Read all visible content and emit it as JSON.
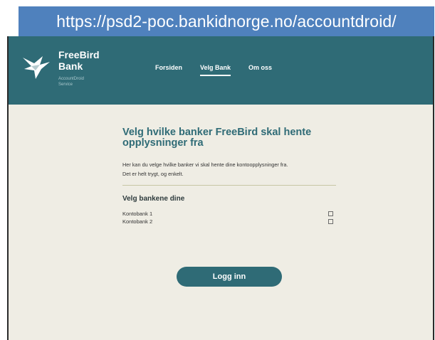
{
  "browser": {
    "url": "https://psd2-poc.bankidnorge.no/accountdroid/"
  },
  "header": {
    "logo": {
      "name_line1": "FreeBird",
      "name_line2": "Bank",
      "sub_line1": "AccountDroid",
      "sub_line2": "Service",
      "icon": "bird-logo-icon"
    },
    "nav": [
      {
        "label": "Forsiden",
        "active": false
      },
      {
        "label": "Velg Bank",
        "active": true
      },
      {
        "label": "Om oss",
        "active": false
      }
    ],
    "background_color": "#2f6b76"
  },
  "main": {
    "title": "Velg hvilke banker FreeBird skal hente opplysninger fra",
    "intro": "Her kan du velge hvilke banker vi skal hente dine kontoopplysninger fra. Det er helt trygt, og enkelt.",
    "section_title": "Velg bankene dine",
    "banks": [
      {
        "label": "Kontobank 1",
        "checked": false
      },
      {
        "label": "Kontobank 2",
        "checked": false
      }
    ],
    "login_label": "Logg inn"
  },
  "colors": {
    "accent": "#2f6b76",
    "url_bar": "#4f81bd",
    "page_bg": "#efede4"
  }
}
